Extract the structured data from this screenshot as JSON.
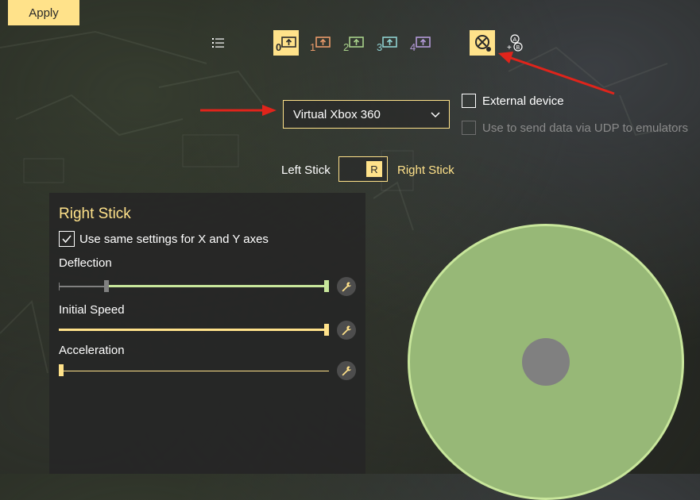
{
  "toolbar": {
    "apply_label": "Apply",
    "slots": [
      {
        "number": "0",
        "color": "#2a2a2a",
        "active": true
      },
      {
        "number": "1",
        "color": "#e89a6a"
      },
      {
        "number": "2",
        "color": "#a8d08a"
      },
      {
        "number": "3",
        "color": "#8fd0d0"
      },
      {
        "number": "4",
        "color": "#b39ad8"
      }
    ],
    "icons": [
      "list-icon",
      "xbox-icon",
      "buttons-combo-icon"
    ]
  },
  "controller": {
    "selected": "Virtual Xbox 360",
    "external_device_label": "External device",
    "udp_label": "Use to send data via UDP to emulators"
  },
  "stick_toggle": {
    "left_label": "Left Stick",
    "right_label": "Right Stick",
    "knob_label": "R"
  },
  "panel": {
    "title": "Right Stick",
    "same_settings_label": "Use same settings for X and Y axes",
    "deflection": {
      "label": "Deflection",
      "low": 0.17,
      "high": 1.0
    },
    "initial_speed": {
      "label": "Initial Speed",
      "value": 1.0
    },
    "acceleration": {
      "label": "Acceleration",
      "value": 0.0
    }
  },
  "colors": {
    "accent": "#ffe28a",
    "joystick": "#97b877",
    "annotation": "#e0241b"
  }
}
